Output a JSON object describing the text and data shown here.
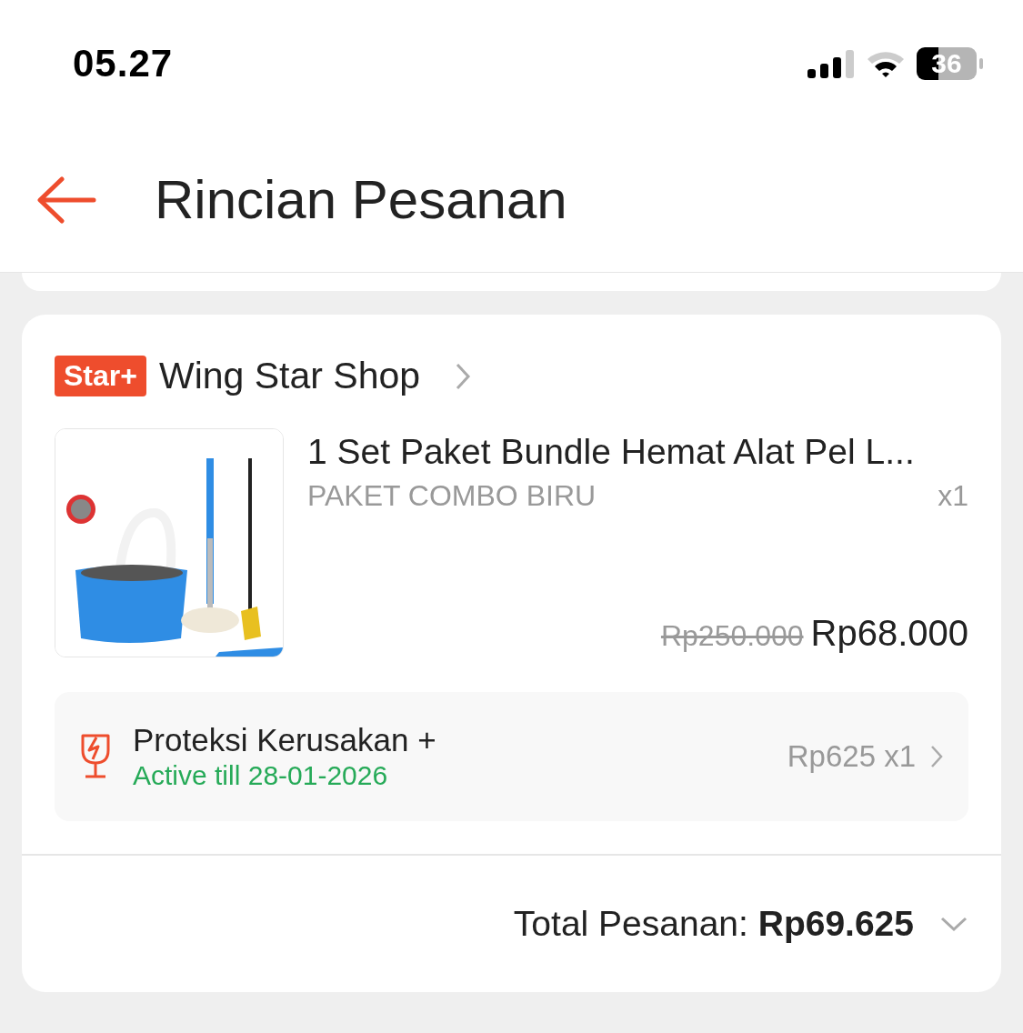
{
  "status_bar": {
    "time": "05.27",
    "battery": "36"
  },
  "header": {
    "title": "Rincian Pesanan"
  },
  "shop": {
    "badge": "Star+",
    "name": "Wing Star Shop"
  },
  "product": {
    "name": "1 Set Paket Bundle Hemat Alat Pel L...",
    "variant": "PAKET COMBO BIRU",
    "quantity": "x1",
    "original_price": "Rp250.000",
    "price": "Rp68.000"
  },
  "protection": {
    "title": "Proteksi Kerusakan +",
    "status": "Active till 28-01-2026",
    "price": "Rp625 x1"
  },
  "total": {
    "text": "Total Pesanan: **Rp69.625**",
    "expanded": false
  }
}
